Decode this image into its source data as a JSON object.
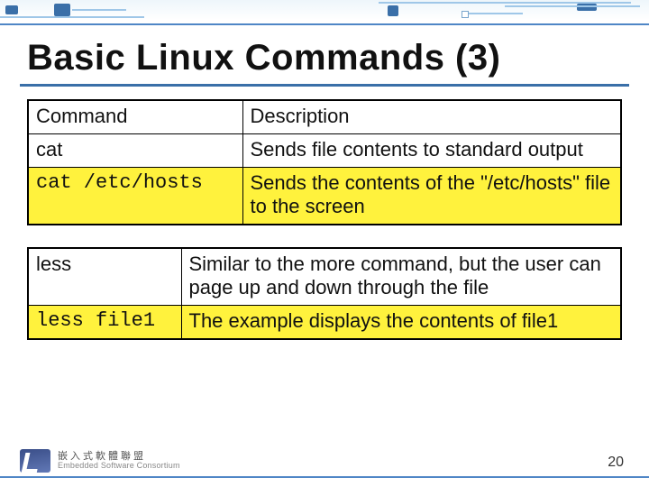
{
  "title": "Basic Linux Commands (3)",
  "table1": {
    "head": {
      "cmd": "Command",
      "desc": "Description"
    },
    "rows": [
      {
        "cmd": "cat",
        "desc": "Sends file contents to standard output",
        "hl": false,
        "mono": false
      },
      {
        "cmd": "cat /etc/hosts",
        "desc": "Sends the contents of the \"/etc/hosts\" file to the screen",
        "hl": true,
        "mono": true
      }
    ]
  },
  "table2": {
    "rows": [
      {
        "cmd": "less",
        "desc": "Similar to the more command, but the user can page up and down through the file",
        "hl": false,
        "mono": false
      },
      {
        "cmd": "less file1",
        "desc": "The example displays the contents of file1",
        "hl": true,
        "mono": true
      }
    ]
  },
  "footer": {
    "org_cn": "嵌入式軟體聯盟",
    "org_en": "Embedded Software Consortium",
    "page": "20"
  }
}
